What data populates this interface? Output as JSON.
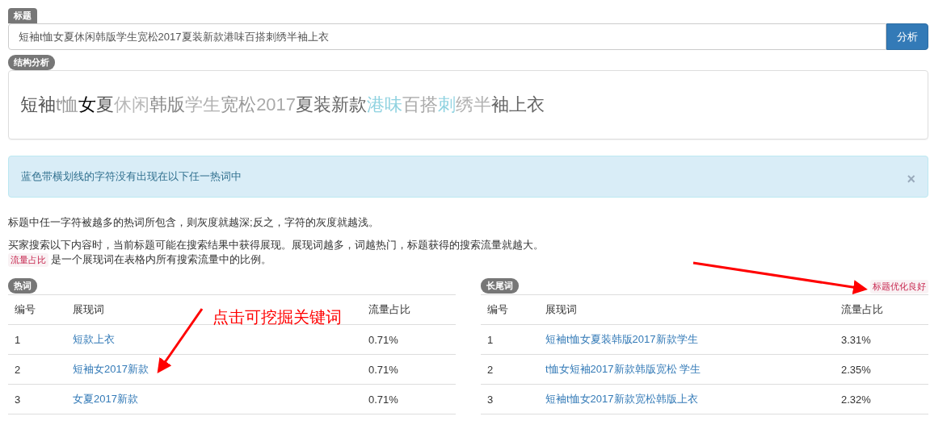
{
  "title_label": "标题",
  "title_input": {
    "value": "短袖t恤女夏休闲韩版学生宽松2017夏装新款港味百搭刺绣半袖上衣"
  },
  "analyze_button": "分析",
  "structure_label": "结构分析",
  "structure_segments": [
    {
      "text": "短袖",
      "color": "#555555"
    },
    {
      "text": "t恤",
      "color": "#999999"
    },
    {
      "text": "女",
      "color": "#000000"
    },
    {
      "text": "夏",
      "color": "#555555"
    },
    {
      "text": "休闲",
      "color": "#b8b8b8"
    },
    {
      "text": "韩版",
      "color": "#888888"
    },
    {
      "text": "学生",
      "color": "#b0b0b0"
    },
    {
      "text": "宽松",
      "color": "#999999"
    },
    {
      "text": "2017",
      "color": "#aaaaaa"
    },
    {
      "text": "夏装新款",
      "color": "#666666"
    },
    {
      "text": "港味",
      "color": "#8fd2e0"
    },
    {
      "text": "百搭",
      "color": "#a8a8a8"
    },
    {
      "text": "刺",
      "color": "#8fd2e0"
    },
    {
      "text": "绣半",
      "color": "#b0b0b0"
    },
    {
      "text": "袖上衣",
      "color": "#666666"
    }
  ],
  "alert": {
    "text": "蓝色带横划线的字符没有出现在以下任一热词中",
    "close": "×"
  },
  "notes": [
    "标题中任一字符被越多的热词所包含，则灰度就越深;反之，字符的灰度就越浅。",
    "买家搜索以下内容时，当前标题可能在搜索结果中获得展现。展现词越多，词越热门，标题获得的搜索流量就越大。"
  ],
  "ratio_note": {
    "tag": "流量占比",
    "text": "是一个展现词在表格内所有搜索流量中的比例。"
  },
  "tables": [
    {
      "label": "热词",
      "columns": [
        "编号",
        "展现词",
        "流量占比"
      ],
      "rows": [
        [
          "1",
          "短款上衣",
          "0.71%"
        ],
        [
          "2",
          "短袖女2017新款",
          "0.71%"
        ],
        [
          "3",
          "女夏2017新款",
          "0.71%"
        ]
      ]
    },
    {
      "label": "长尾词",
      "status": "标题优化良好",
      "columns": [
        "编号",
        "展现词",
        "流量占比"
      ],
      "rows": [
        [
          "1",
          "短袖t恤女夏装韩版2017新款学生",
          "3.31%"
        ],
        [
          "2",
          "t恤女短袖2017新款韩版宽松 学生",
          "2.35%"
        ],
        [
          "3",
          "短袖t恤女2017新款宽松韩版上衣",
          "2.32%"
        ]
      ]
    }
  ],
  "annotation": "点击可挖掘关键词"
}
